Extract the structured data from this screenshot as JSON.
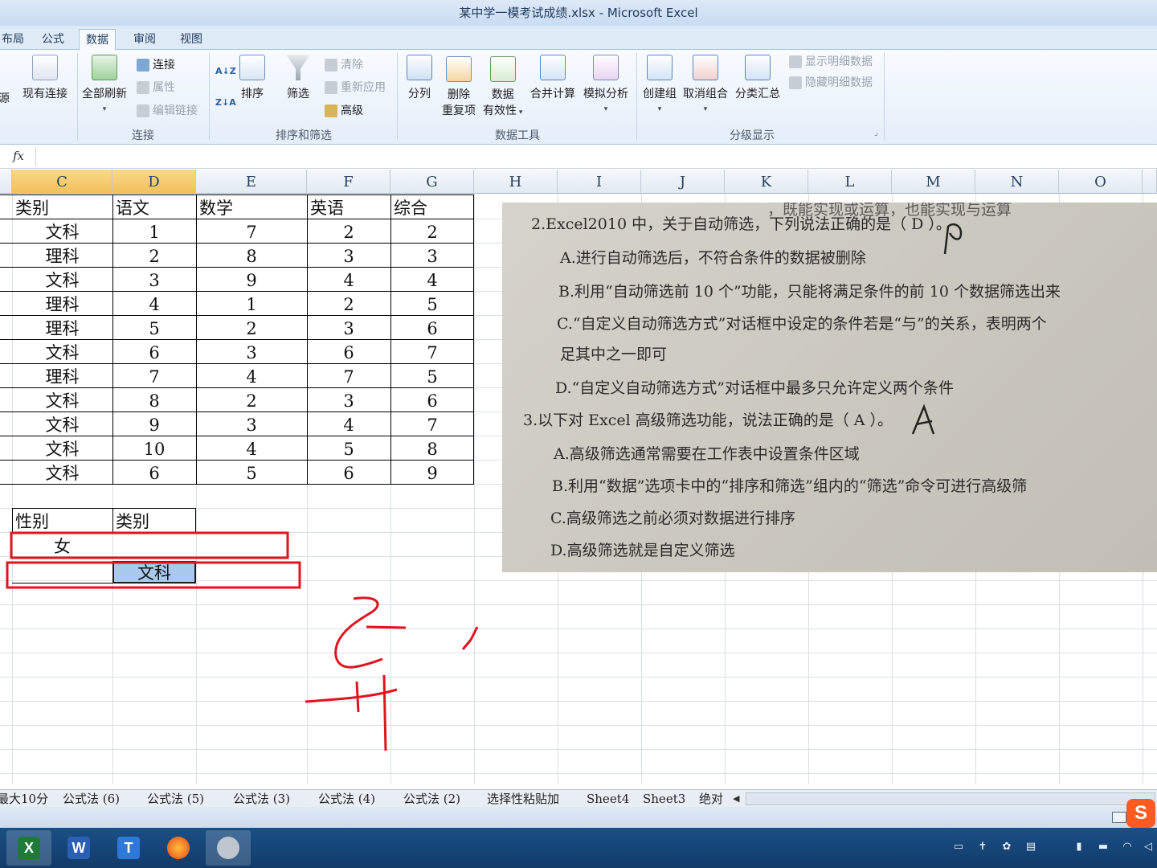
{
  "window": {
    "title": "某中学一模考试成绩.xlsx - Microsoft Excel"
  },
  "ribbon_tabs": [
    "布局",
    "公式",
    "数据",
    "审阅",
    "视图"
  ],
  "active_tab": "数据",
  "ribbon": {
    "source_partial": "源",
    "existing_connections": "现有连接",
    "refresh_all": "全部刷新",
    "connections": "连接",
    "properties": "属性",
    "edit_links": "编辑链接",
    "group_connections": "连接",
    "sort_az": "A↓Z",
    "sort_za": "Z↓A",
    "sort": "排序",
    "filter": "筛选",
    "clear": "清除",
    "reapply": "重新应用",
    "advanced": "高级",
    "group_sort_filter": "排序和筛选",
    "text_to_columns": "分列",
    "remove_duplicates_1": "删除",
    "remove_duplicates_2": "重复项",
    "data_validation_1": "数据",
    "data_validation_2": "有效性",
    "consolidate": "合并计算",
    "what_if": "模拟分析",
    "group_data_tools": "数据工具",
    "group_btn": "创建组",
    "ungroup_btn": "取消组合",
    "subtotal": "分类汇总",
    "show_detail": "显示明细数据",
    "hide_detail": "隐藏明细数据",
    "group_outline": "分级显示"
  },
  "formula_bar": {
    "fx": "fx",
    "value": ""
  },
  "columns": [
    "C",
    "D",
    "E",
    "F",
    "G",
    "H",
    "I",
    "J",
    "K",
    "L",
    "M",
    "N",
    "O"
  ],
  "selected_column": "D",
  "table": {
    "headers": [
      "类别",
      "语文",
      "数学",
      "英语",
      "综合"
    ],
    "rows": [
      [
        "文科",
        "1",
        "7",
        "2",
        "2"
      ],
      [
        "理科",
        "2",
        "8",
        "3",
        "3"
      ],
      [
        "文科",
        "3",
        "9",
        "4",
        "4"
      ],
      [
        "理科",
        "4",
        "1",
        "2",
        "5"
      ],
      [
        "理科",
        "5",
        "2",
        "3",
        "6"
      ],
      [
        "文科",
        "6",
        "3",
        "6",
        "7"
      ],
      [
        "理科",
        "7",
        "4",
        "7",
        "5"
      ],
      [
        "文科",
        "8",
        "2",
        "3",
        "6"
      ],
      [
        "文科",
        "9",
        "3",
        "4",
        "7"
      ],
      [
        "文科",
        "10",
        "4",
        "5",
        "8"
      ],
      [
        "文科",
        "6",
        "5",
        "6",
        "9"
      ]
    ]
  },
  "criteria": {
    "headers": [
      "性别",
      "类别"
    ],
    "row1": [
      "女",
      ""
    ],
    "row2": [
      "",
      "文科"
    ]
  },
  "photo_text": {
    "line0": "，既能实现或运算，也能实现与运算",
    "line1": "2.Excel2010 中，关于自动筛选，下列说法正确的是（ D ）。",
    "line2": "A.进行自动筛选后，不符合条件的数据被删除",
    "line3": "B.利用“自动筛选前 10 个”功能，只能将满足条件的前 10 个数据筛选出来",
    "line4": "C.“自定义自动筛选方式”对话框中设定的条件若是“与”的关系，表明两个",
    "line5": "足其中之一即可",
    "line6": "D.“自定义自动筛选方式”对话框中最多只允许定义两个条件",
    "line7": "3.以下对 Excel 高级筛选功能，说法正确的是（ A ）。",
    "line8": "A.高级筛选通常需要在工作表中设置条件区域",
    "line9": "B.利用“数据”选项卡中的“排序和筛选”组内的“筛选”命令可进行高级筛",
    "line10": "C.高级筛选之前必须对数据进行排序",
    "line11": "D.高级筛选就是自定义筛选"
  },
  "sheet_tabs": [
    "最大10分",
    "公式法 (6)",
    "公式法 (5)",
    "公式法 (3)",
    "公式法 (4)",
    "公式法 (2)",
    "选择性粘贴加",
    "Sheet4",
    "Sheet3",
    "绝对"
  ],
  "colors": {
    "annotation_red": "#e0141e",
    "selection_blue": "#a9c9ef",
    "selected_header": "#f1c15b"
  }
}
